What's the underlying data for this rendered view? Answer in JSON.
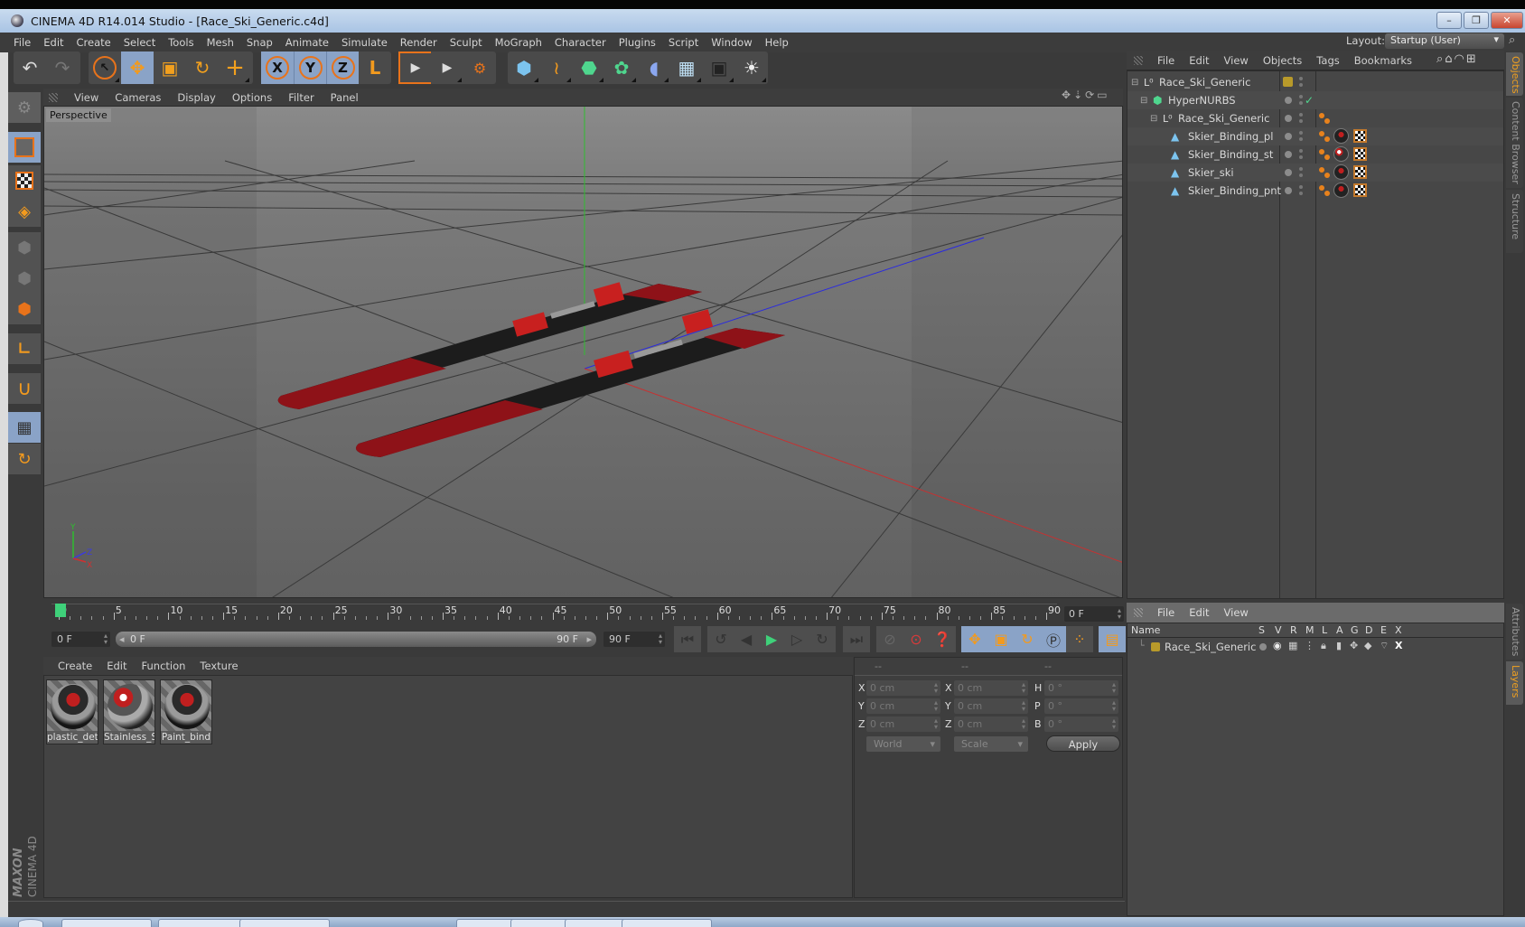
{
  "window": {
    "title": "CINEMA 4D R14.014 Studio - [Race_Ski_Generic.c4d]",
    "minimize": "–",
    "restore": "❐",
    "close": "✕"
  },
  "menubar": {
    "items": [
      "File",
      "Edit",
      "Create",
      "Select",
      "Tools",
      "Mesh",
      "Snap",
      "Animate",
      "Simulate",
      "Render",
      "Sculpt",
      "MoGraph",
      "Character",
      "Plugins",
      "Script",
      "Window",
      "Help"
    ],
    "layout_label": "Layout:",
    "layout_value": "Startup (User)"
  },
  "toolbar": {
    "undo": "↶",
    "redo": "↷",
    "live_select": "↖",
    "move": "✥",
    "scale": "▣",
    "rotate": "↻",
    "add": "+",
    "x": "X",
    "y": "Y",
    "z": "Z",
    "coord_system": "L",
    "render_view": "▶",
    "render_picture": "▶",
    "render_settings": "⚙",
    "cube": "⬢",
    "spline": "≀",
    "nurbs": "⬣",
    "array": "✿",
    "deformer": "◖",
    "floor": "▦",
    "camera": "▣",
    "light": "☀"
  },
  "left_toolbar": {
    "items": [
      "model-mode",
      "texture-mode",
      "workplane-mode",
      "points-mode",
      "edges-mode",
      "polygons-mode",
      "axis-mode",
      "snap",
      "locked-workplane",
      "planar-workplane"
    ]
  },
  "viewport": {
    "menu": [
      "View",
      "Cameras",
      "Display",
      "Options",
      "Filter",
      "Panel"
    ],
    "label": "Perspective",
    "axis_labels": {
      "y": "Y",
      "z": "Z",
      "x": "X"
    }
  },
  "timeline": {
    "ticks": [
      0,
      5,
      10,
      15,
      20,
      25,
      30,
      35,
      40,
      45,
      50,
      55,
      60,
      65,
      70,
      75,
      80,
      85,
      90
    ],
    "current_frame": "0 F",
    "start_frame": "0 F",
    "range_start": "0 F",
    "range_end": "90 F",
    "end_frame": "90 F",
    "playhead_frame": 0
  },
  "materials": {
    "menu": [
      "Create",
      "Edit",
      "Function",
      "Texture"
    ],
    "items": [
      {
        "name": "plastic_det"
      },
      {
        "name": "Stainless_S"
      },
      {
        "name": "Paint_bind"
      }
    ]
  },
  "coordinates": {
    "headers": [
      "--",
      "--",
      "--"
    ],
    "rows": [
      {
        "pos_label": "X",
        "pos": "0 cm",
        "size_label": "X",
        "size": "0 cm",
        "rot_label": "H",
        "rot": "0 °"
      },
      {
        "pos_label": "Y",
        "pos": "0 cm",
        "size_label": "Y",
        "size": "0 cm",
        "rot_label": "P",
        "rot": "0 °"
      },
      {
        "pos_label": "Z",
        "pos": "0 cm",
        "size_label": "Z",
        "size": "0 cm",
        "rot_label": "B",
        "rot": "0 °"
      }
    ],
    "mode": "World",
    "size_mode": "Scale",
    "apply": "Apply"
  },
  "objects": {
    "menu": [
      "File",
      "Edit",
      "View",
      "Objects",
      "Tags",
      "Bookmarks"
    ],
    "items": [
      {
        "name": "Race_Ski_Generic",
        "type": "null"
      },
      {
        "name": "HyperNURBS",
        "type": "hypernurbs"
      },
      {
        "name": "Race_Ski_Generic",
        "type": "null"
      },
      {
        "name": "Skier_Binding_pl",
        "type": "polygon"
      },
      {
        "name": "Skier_Binding_st",
        "type": "polygon"
      },
      {
        "name": "Skier_ski",
        "type": "polygon"
      },
      {
        "name": "Skier_Binding_pnt",
        "type": "polygon"
      }
    ]
  },
  "side_tabs": {
    "top": [
      "Objects",
      "Content Browser",
      "Structure"
    ],
    "bottom": [
      "Attributes",
      "Layers"
    ]
  },
  "layers": {
    "menu": [
      "File",
      "Edit",
      "View"
    ],
    "columns": [
      "Name",
      "S",
      "V",
      "R",
      "M",
      "L",
      "A",
      "G",
      "D",
      "E",
      "X"
    ],
    "rows": [
      {
        "name": "Race_Ski_Generic",
        "color": "#b89a2a"
      }
    ]
  },
  "branding": {
    "maxon": "MAXON",
    "product": "CINEMA 4D"
  },
  "colors": {
    "accent_orange": "#e8731b",
    "selected_blue": "#8aa3c7",
    "active_tab": "#f0a020",
    "playhead_green": "#3fd17a"
  }
}
